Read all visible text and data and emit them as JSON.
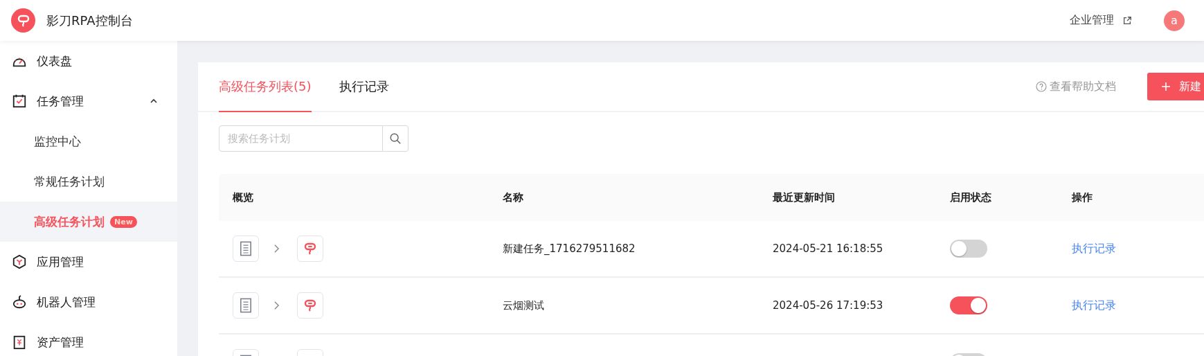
{
  "app": {
    "title": "影刀RPA控制台",
    "enterprise_link": "企业管理",
    "avatar": "a"
  },
  "sidebar": {
    "items": [
      {
        "label": "仪表盘",
        "kind": "gauge",
        "selected": false
      },
      {
        "label": "任务管理",
        "kind": "calendar",
        "selected": false,
        "expanded": true,
        "children": [
          {
            "label": "监控中心",
            "selected": false
          },
          {
            "label": "常规任务计划",
            "selected": false
          },
          {
            "label": "高级任务计划",
            "selected": true,
            "badge": "New"
          }
        ]
      },
      {
        "label": "应用管理",
        "kind": "hexagon",
        "selected": false
      },
      {
        "label": "机器人管理",
        "kind": "robot",
        "selected": false
      },
      {
        "label": "资产管理",
        "kind": "asset",
        "selected": false
      }
    ]
  },
  "tabs": [
    {
      "label": "高级任务列表(5)",
      "selected": true
    },
    {
      "label": "执行记录",
      "selected": false
    }
  ],
  "help_link": "查看帮助文档",
  "new_button": "新建",
  "search": {
    "placeholder": "搜索任务计划"
  },
  "table": {
    "columns": [
      "概览",
      "名称",
      "最近更新时间",
      "启用状态",
      "操作"
    ],
    "rows": [
      {
        "name": "新建任务_1716279511682",
        "updated": "2024-05-21 16:18:55",
        "enabled": false,
        "action": "执行记录"
      },
      {
        "name": "云烟测试",
        "updated": "2024-05-26 17:19:53",
        "enabled": true,
        "action": "执行记录"
      },
      {
        "enabled": false
      }
    ]
  }
}
